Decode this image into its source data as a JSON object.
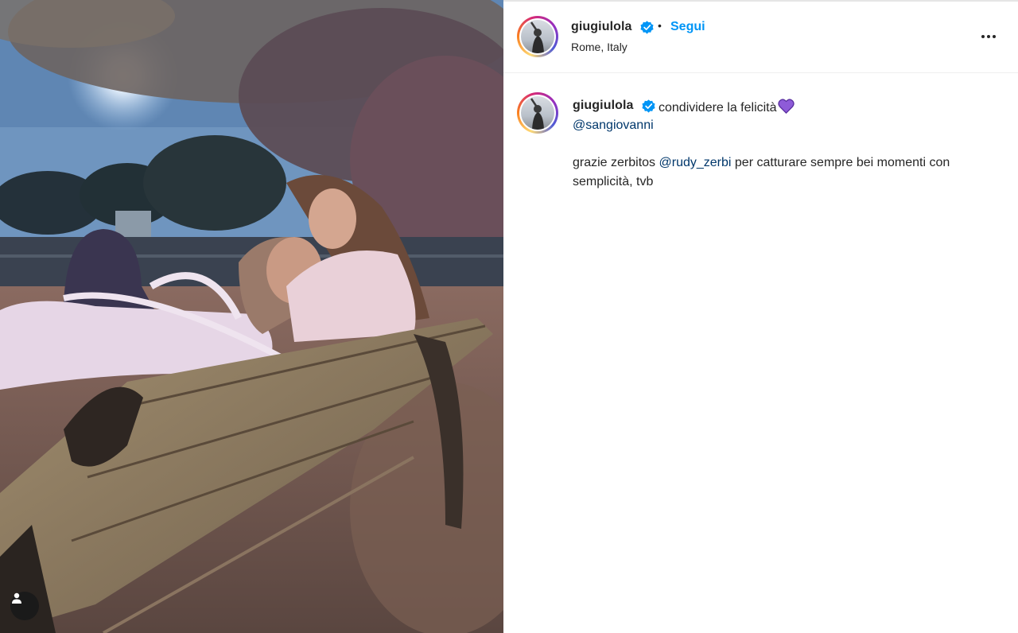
{
  "post": {
    "username": "giugiulola",
    "verified": true,
    "separator": "•",
    "follow_label": "Segui",
    "location": "Rome, Italy",
    "more_icon": "more-horizontal-icon"
  },
  "caption": {
    "username": "giugiulola",
    "text_line1": "condividere la felicità",
    "emoji": "purple-heart",
    "mention_line": "@sangiovanni",
    "body_prefix": "grazie zerbitos ",
    "body_mention": "@rudy_zerbi",
    "body_suffix": " per catturare sempre bei momenti con semplicità, tvb"
  },
  "photo": {
    "user_tag_icon": "user-tag-icon"
  },
  "colors": {
    "accent": "#0095f6",
    "mention": "#00376b",
    "verified": "#0095f6",
    "heart": "#8e5bd8"
  }
}
